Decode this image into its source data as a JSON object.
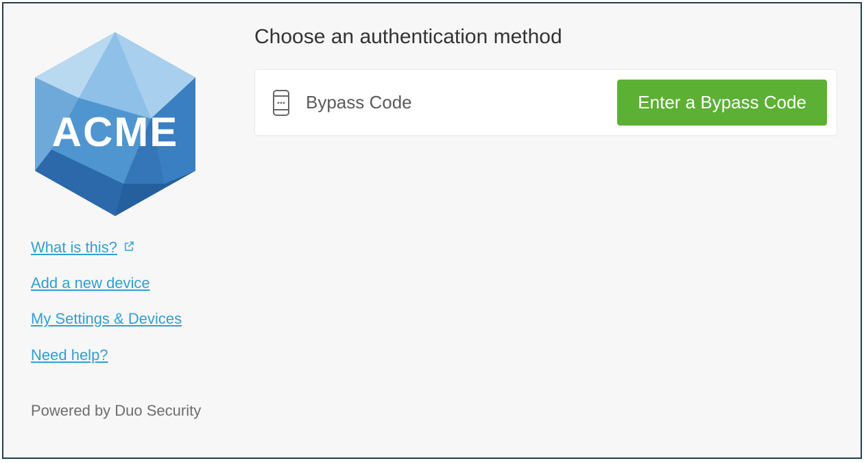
{
  "logo": {
    "text": "ACME"
  },
  "sidebar": {
    "links": [
      {
        "label": "What is this?"
      },
      {
        "label": "Add a new device"
      },
      {
        "label": "My Settings & Devices"
      },
      {
        "label": "Need help?"
      }
    ],
    "powered": "Powered by Duo Security"
  },
  "main": {
    "heading": "Choose an authentication method",
    "method": {
      "label": "Bypass Code",
      "button": "Enter a Bypass Code"
    }
  },
  "colors": {
    "link": "#309ed6",
    "button": "#5cb034",
    "border": "#1f3b4d"
  }
}
